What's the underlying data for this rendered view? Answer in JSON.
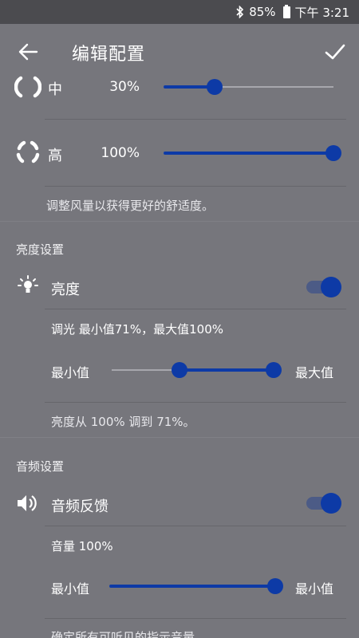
{
  "status_bar": {
    "bluetooth_icon": "bluetooth-icon",
    "battery_percent": "85%",
    "battery_icon": "battery-icon",
    "time": "下午 3:21"
  },
  "app_bar": {
    "title": "编辑配置",
    "back_icon": "arrow-left-icon",
    "confirm_icon": "check-icon"
  },
  "fan_levels": [
    {
      "label": "中",
      "value_text": "30%",
      "value": 0.3
    },
    {
      "label": "高",
      "value_text": "100%",
      "value": 1.0
    }
  ],
  "fan_helper": "调整风量以获得更好的舒适度。",
  "brightness_section": {
    "header": "亮度设置",
    "setting_label": "亮度",
    "toggle_on": true,
    "dimming_text": "调光 最小值71%，最大值100%",
    "min_label": "最小值",
    "max_label": "最大值",
    "range_min": 0.71,
    "range_max": 1.0,
    "helper": "亮度从 100% 调到 71%。"
  },
  "audio_section": {
    "header": "音频设置",
    "setting_label": "音频反馈",
    "toggle_on": true,
    "volume_text": "音量 100%",
    "min_label": "最小值",
    "max_label": "最小值",
    "volume": 1.0,
    "helper": "确定所有可听见的指示音量"
  },
  "colors": {
    "background": "#76767c",
    "status_bar": "#4b4b4f",
    "accent": "#0d3aa6"
  }
}
